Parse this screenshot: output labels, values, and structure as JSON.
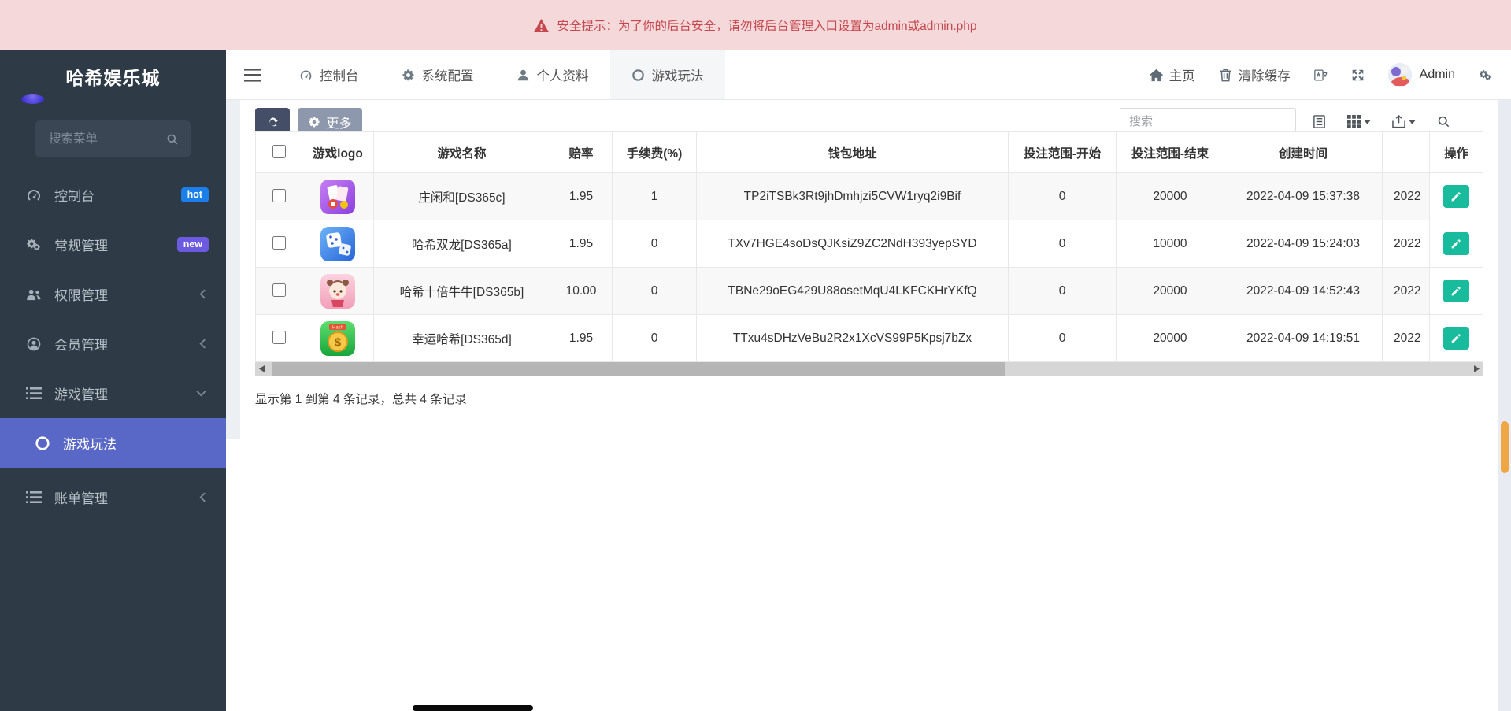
{
  "banner": {
    "text": "安全提示：为了你的后台安全，请勿将后台管理入口设置为admin或admin.php"
  },
  "sidebar": {
    "title": "哈希娱乐城",
    "search_placeholder": "搜索菜单",
    "items": [
      {
        "key": "console",
        "label": "控制台",
        "icon": "dashboard-icon",
        "badge": "hot",
        "badge_color": "#1a7fe8"
      },
      {
        "key": "general",
        "label": "常规管理",
        "icon": "cogs-icon",
        "badge": "new",
        "badge_color": "#6c5be0"
      },
      {
        "key": "auth",
        "label": "权限管理",
        "icon": "users-icon",
        "chevron": "left"
      },
      {
        "key": "member",
        "label": "会员管理",
        "icon": "user-circle-icon",
        "chevron": "left"
      },
      {
        "key": "game",
        "label": "游戏管理",
        "icon": "list-icon",
        "chevron": "down"
      },
      {
        "key": "gameplay",
        "label": "游戏玩法",
        "icon": "circle-icon",
        "active": true,
        "submenu": true
      },
      {
        "key": "billing",
        "label": "账单管理",
        "icon": "list-icon",
        "chevron": "left"
      }
    ]
  },
  "navbar": {
    "tabs": [
      {
        "key": "console",
        "label": "控制台",
        "icon": "dashboard-icon"
      },
      {
        "key": "system-config",
        "label": "系统配置",
        "icon": "gear-icon"
      },
      {
        "key": "profile",
        "label": "个人资料",
        "icon": "user-icon"
      },
      {
        "key": "gameplay",
        "label": "游戏玩法",
        "icon": "circle-icon",
        "active": true
      }
    ],
    "home_label": "主页",
    "clear_cache_label": "清除缓存",
    "username": "Admin"
  },
  "toolbar": {
    "more_label": "更多",
    "search_placeholder": "搜索"
  },
  "table": {
    "columns": [
      {
        "key": "select",
        "label": ""
      },
      {
        "key": "logo",
        "label": "游戏logo"
      },
      {
        "key": "name",
        "label": "游戏名称"
      },
      {
        "key": "odds",
        "label": "赔率"
      },
      {
        "key": "fee",
        "label": "手续费(%)"
      },
      {
        "key": "wallet",
        "label": "钱包地址"
      },
      {
        "key": "bet_start",
        "label": "投注范围-开始"
      },
      {
        "key": "bet_end",
        "label": "投注范围-结束"
      },
      {
        "key": "created",
        "label": "创建时间"
      },
      {
        "key": "updated",
        "label": ""
      },
      {
        "key": "actions",
        "label": "操作"
      }
    ],
    "rows": [
      {
        "logo": "purple-cards",
        "name": "庄闲和[DS365c]",
        "odds": "1.95",
        "fee": "1",
        "wallet": "TP2iTSBk3Rt9jhDmhjzi5CVW1ryq2i9Bif",
        "bet_start": "0",
        "bet_end": "20000",
        "created": "2022-04-09 15:37:38",
        "updated": "2022"
      },
      {
        "logo": "blue-dice",
        "name": "哈希双龙[DS365a]",
        "odds": "1.95",
        "fee": "0",
        "wallet": "TXv7HGE4soDsQJKsiZ9ZC2NdH393yepSYD",
        "bet_start": "0",
        "bet_end": "10000",
        "created": "2022-04-09 15:24:03",
        "updated": "2022"
      },
      {
        "logo": "pink-character",
        "name": "哈希十倍牛牛[DS365b]",
        "odds": "10.00",
        "fee": "0",
        "wallet": "TBNe29oEG429U88osetMqU4LKFCKHrYKfQ",
        "bet_start": "0",
        "bet_end": "20000",
        "created": "2022-04-09 14:52:43",
        "updated": "2022"
      },
      {
        "logo": "green-coin",
        "name": "幸运哈希[DS365d]",
        "odds": "1.95",
        "fee": "0",
        "wallet": "TTxu4sDHzVeBu2R2x1XcVS99P5Kpsj7bZx",
        "bet_start": "0",
        "bet_end": "20000",
        "created": "2022-04-09 14:19:51",
        "updated": "2022"
      }
    ]
  },
  "footer": {
    "summary": "显示第 1 到第 4 条记录，总共 4 条记录"
  },
  "colors": {
    "banner_bg": "#f5d8da",
    "banner_text": "#c5484e",
    "sidebar_bg": "#2e3a45",
    "active_item": "#5968c6",
    "hot_badge": "#1a7fe8",
    "new_badge": "#6c5be0",
    "refresh_button": "#444e66",
    "more_button": "#8e98ac",
    "edit_button": "#18bc9c",
    "scroll_thumb": "#efa743"
  }
}
